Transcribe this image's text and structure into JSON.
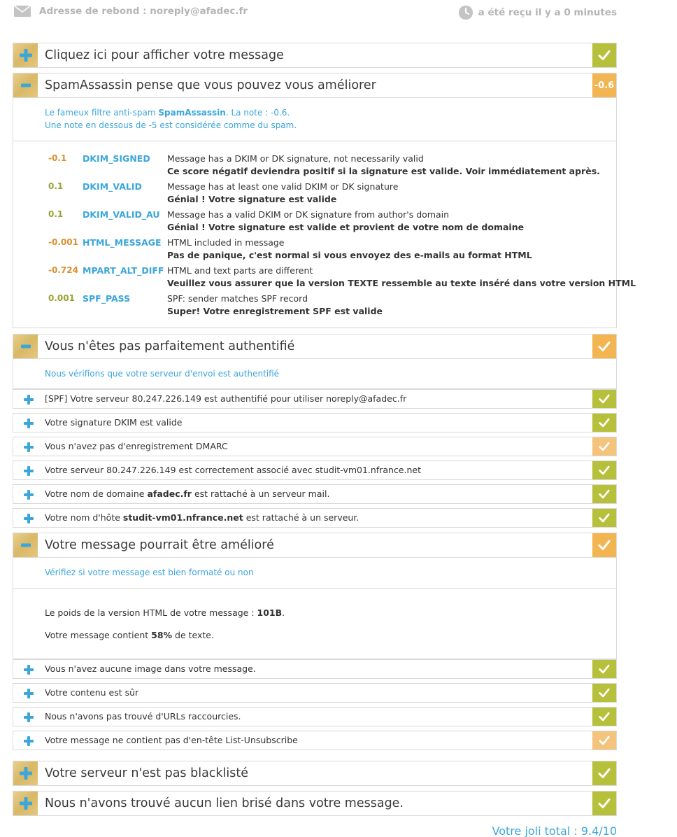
{
  "header": {
    "bounce_label": "Adresse de rebond : noreply@afadec.fr",
    "received_label": "a été reçu il y a 0 minutes"
  },
  "sections": {
    "message": {
      "title": "Cliquez ici pour afficher votre message"
    },
    "spamassassin": {
      "title": "SpamAssassin pense que vous pouvez vous améliorer",
      "score": "-0.6",
      "intro_prefix": "Le fameux filtre anti-spam ",
      "intro_brand": "SpamAssassin",
      "intro_suffix": ". La note : -0.6.",
      "intro_line2": "Une note en dessous de -5 est considérée comme du spam.",
      "rules": [
        {
          "score": "-0.1",
          "code": "DKIM_SIGNED",
          "desc": "Message has a DKIM or DK signature, not necessarily valid",
          "tip": "Ce score négatif deviendra positif si la signature est valide. Voir immédiatement après."
        },
        {
          "score": "0.1",
          "code": "DKIM_VALID",
          "desc": "Message has at least one valid DKIM or DK signature",
          "tip": "Génial ! Votre signature est valide"
        },
        {
          "score": "0.1",
          "code": "DKIM_VALID_AU",
          "desc": "Message has a valid DKIM or DK signature from author's domain",
          "tip": "Génial ! Votre signature est valide et provient de votre nom de domaine"
        },
        {
          "score": "-0.001",
          "code": "HTML_MESSAGE",
          "desc": "HTML included in message",
          "tip": "Pas de panique, c'est normal si vous envoyez des e-mails au format HTML"
        },
        {
          "score": "-0.724",
          "code": "MPART_ALT_DIFF",
          "desc": "HTML and text parts are different",
          "tip": "Veuillez vous assurer que la version TEXTE ressemble au texte inséré dans votre version HTML"
        },
        {
          "score": "0.001",
          "code": "SPF_PASS",
          "desc": "SPF: sender matches SPF record",
          "tip": "Super! Votre enregistrement SPF est valide"
        }
      ]
    },
    "auth": {
      "title": "Vous n'êtes pas parfaitement authentifié",
      "intro": "Nous vérifions que votre serveur d'envoi est authentifié",
      "items": [
        {
          "text": "[SPF] Votre serveur 80.247.226.149 est authentifié pour utiliser noreply@afadec.fr"
        },
        {
          "text": "Votre signature DKIM est valide"
        },
        {
          "text": "Vous n'avez pas d'enregistrement DMARC"
        },
        {
          "text": "Votre serveur 80.247.226.149 est correctement associé avec studit-vm01.nfrance.net"
        },
        {
          "pre": "Votre nom de domaine ",
          "bold": "afadec.fr",
          "post": " est rattaché à un serveur mail."
        },
        {
          "pre": "Votre nom d'hôte ",
          "bold": "studit-vm01.nfrance.net",
          "post": " est rattaché à un serveur."
        }
      ]
    },
    "format": {
      "title": "Votre message pourrait être amélioré",
      "intro": "Vérifiez si votre message est bien formaté ou non",
      "weight_pre": "Le poids de la version HTML de votre message : ",
      "weight_val": "101B",
      "weight_post": ".",
      "text_pre": "Votre message contient ",
      "text_val": "58%",
      "text_post": " de texte.",
      "items": [
        {
          "text": "Vous n'avez aucune image dans votre message."
        },
        {
          "text": "Votre contenu est sûr"
        },
        {
          "text": "Nous n'avons pas trouvé d'URLs raccourcies."
        },
        {
          "text": "Votre message ne contient pas d'en-tête List-Unsubscribe"
        }
      ]
    },
    "blacklist": {
      "title": "Votre serveur n'est pas blacklisté"
    },
    "links": {
      "title": "Nous n'avons trouvé aucun lien brisé dans votre message."
    }
  },
  "total": "Votre joli total : 9.4/10",
  "colors": {
    "green": "#b7c03b",
    "orange": "#f3b552",
    "orange_light": "#f4c37c",
    "blue": "#3ba6dc",
    "gold": "#d9b865"
  }
}
